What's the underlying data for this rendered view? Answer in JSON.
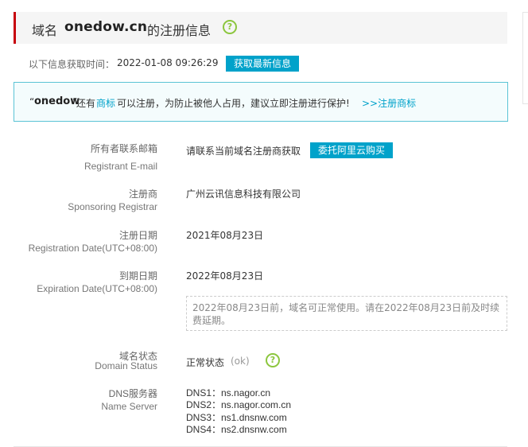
{
  "header": {
    "label_prefix": "域名",
    "domain": "onedow.cn",
    "label_suffix": "的注册信息",
    "help_glyph": "?"
  },
  "query": {
    "label": "以下信息获取时间：",
    "time": "2022-01-08 09:26:29",
    "refresh_button": "获取最新信息"
  },
  "notice": {
    "quote_open": "“",
    "domain": "onedow",
    "quote_close": "”",
    "text_a": "还有",
    "link_trademark": "商标",
    "text_b": "可以注册，为防止被他人占用，建议立即注册进行保护!",
    "link_register": ">>注册商标"
  },
  "fields": {
    "email": {
      "label_cn": "所有者联系邮箱",
      "label_en": "Registrant E-mail",
      "value": "请联系当前域名注册商获取",
      "button": "委托阿里云购买"
    },
    "registrar": {
      "label_cn": "注册商",
      "label_en": "Sponsoring Registrar",
      "value": "广州云讯信息科技有限公司"
    },
    "reg_date": {
      "label_cn": "注册日期",
      "label_en": "Registration Date(UTC+08:00)",
      "value": "2021年08月23日"
    },
    "exp_date": {
      "label_cn": "到期日期",
      "label_en": "Expiration Date(UTC+08:00)",
      "value": "2022年08月23日"
    },
    "exp_note": "2022年08月23日前，域名可正常使用。请在2022年08月23日前及时续费延期。",
    "status": {
      "label_cn": "域名状态",
      "label_en": "Domain Status",
      "value": "正常状态",
      "code": "(ok)",
      "help_glyph": "?"
    },
    "dns": {
      "label_cn": "DNS服务器",
      "label_en": "Name Server",
      "servers": [
        "DNS1：ns.nagor.cn",
        "DNS2：ns.nagor.com.cn",
        "DNS3：ns1.dnsnw.com",
        "DNS4：ns2.dnsnw.com"
      ]
    }
  },
  "colors": {
    "accent": "#00a2ca",
    "brand_red": "#c7000b",
    "help_green": "#8cc63e"
  }
}
